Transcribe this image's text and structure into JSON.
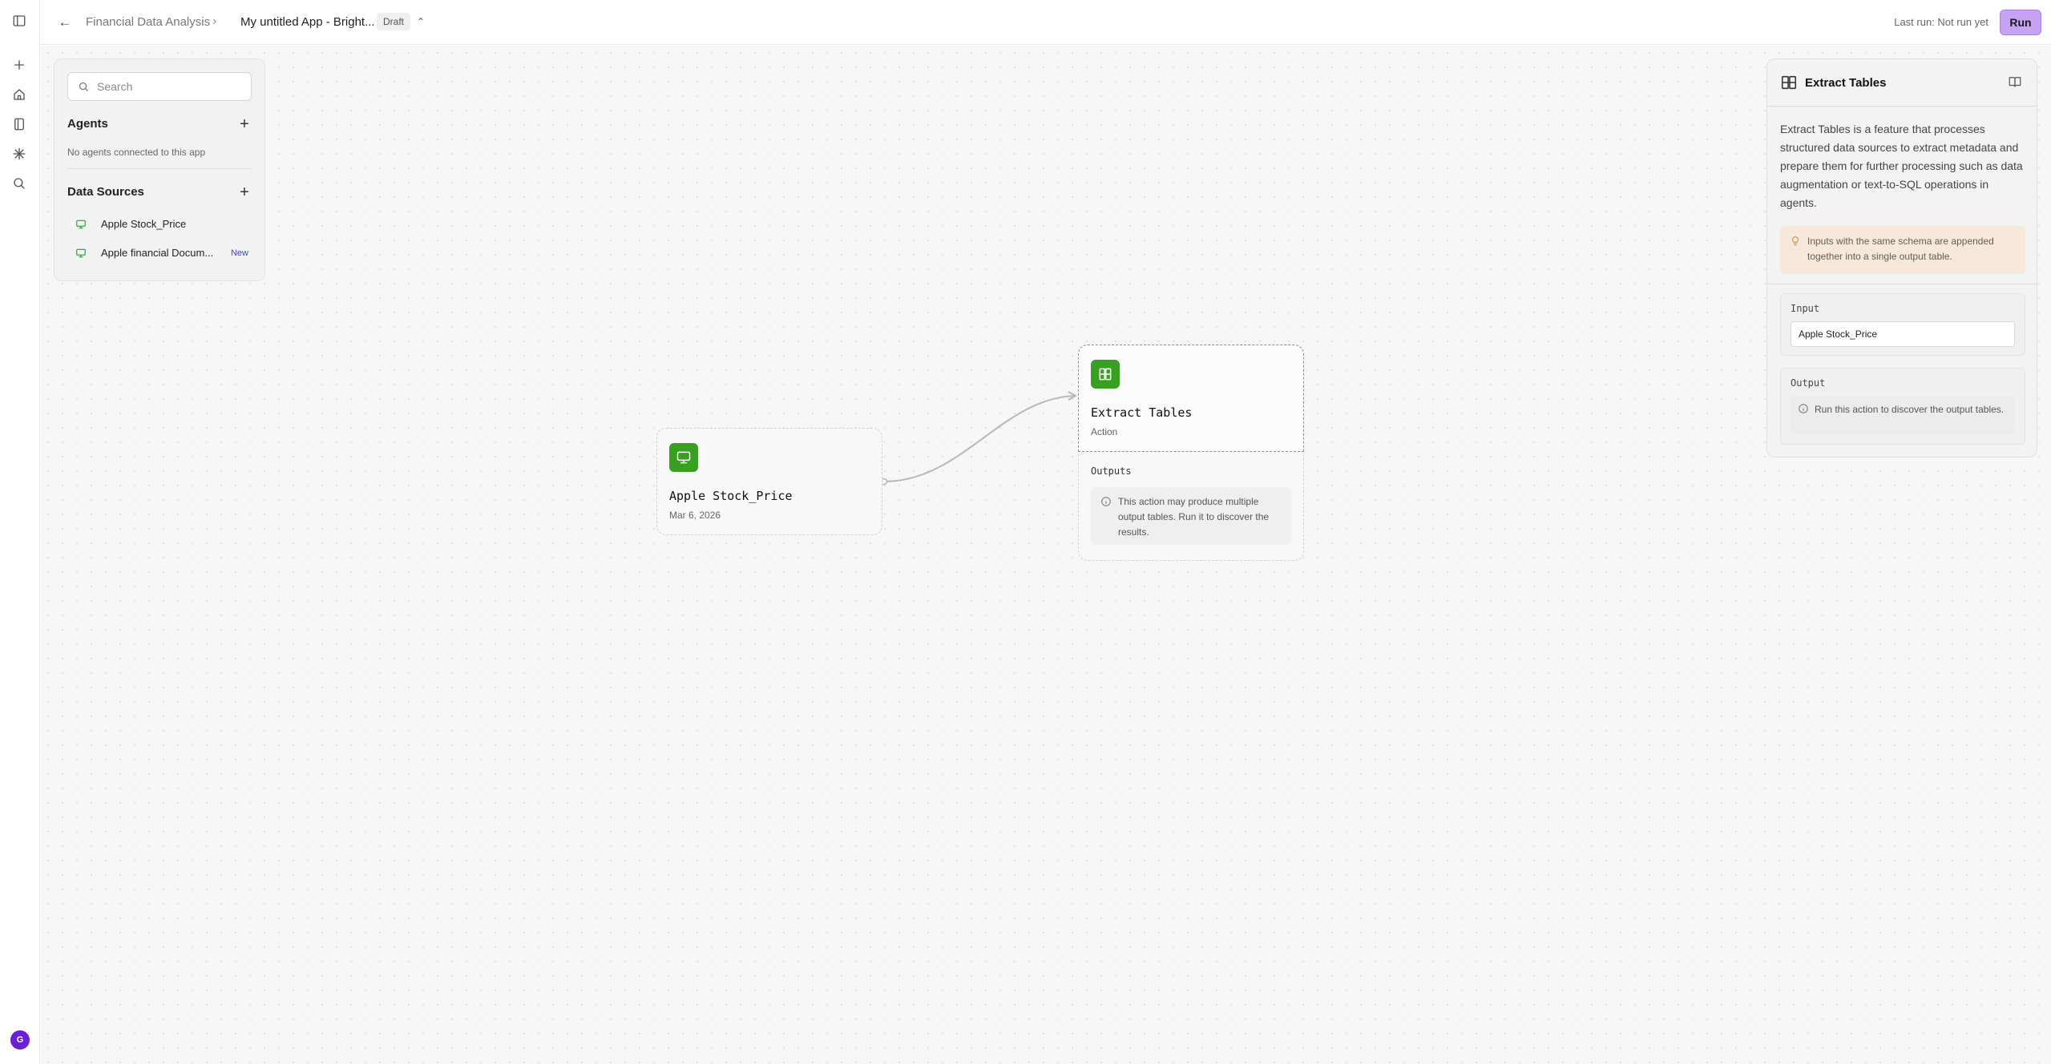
{
  "header": {
    "breadcrumb_parent": "Financial Data Analysis",
    "app_title": "My untitled App - Bright...",
    "status_badge": "Draft",
    "last_run": "Last run: Not run yet",
    "run_label": "Run"
  },
  "rail": {
    "icons": [
      "sidebar-toggle-icon",
      "plus-icon",
      "home-icon",
      "book-icon",
      "asterisk-icon",
      "search-icon"
    ],
    "avatar_initial": "G"
  },
  "left_panel": {
    "search_placeholder": "Search",
    "agents_title": "Agents",
    "agents_empty": "No agents connected to this app",
    "data_sources_title": "Data Sources",
    "data_sources": [
      {
        "label": "Apple Stock_Price",
        "badge": ""
      },
      {
        "label": "Apple financial Docum...",
        "badge": "New"
      }
    ]
  },
  "canvas": {
    "source_node": {
      "title": "Apple Stock_Price",
      "date": "Mar 6, 2026"
    },
    "action_node": {
      "title": "Extract Tables",
      "subtitle": "Action",
      "outputs_label": "Outputs",
      "outputs_text": "This action may produce multiple output tables. Run it to discover the results."
    }
  },
  "right_panel": {
    "title": "Extract Tables",
    "description": "Extract Tables is a feature that processes structured data sources to extract metadata and prepare them for further processing such as data augmentation or text-to-SQL operations in agents.",
    "note": "Inputs with the same schema are appended together into a single output table.",
    "input_label": "Input",
    "input_value": "Apple Stock_Price",
    "output_label": "Output",
    "output_text": "Run this action to discover the output tables."
  },
  "colors": {
    "accent": "#c8a2f5",
    "node_icon": "#38a020",
    "avatar": "#6a1fd6",
    "new_badge": "#3a46c9"
  }
}
